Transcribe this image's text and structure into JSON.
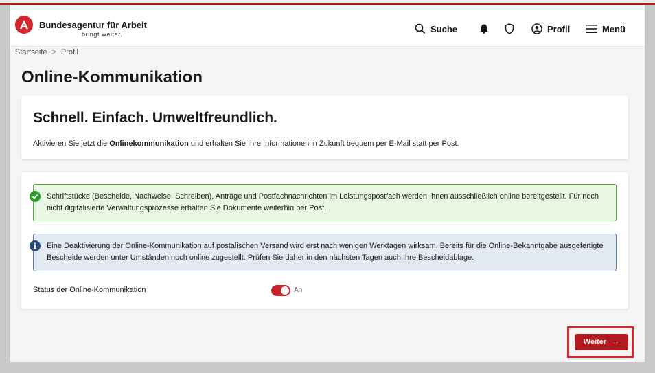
{
  "header": {
    "brand_name": "Bundesagentur für Arbeit",
    "brand_slogan": "bringt weiter.",
    "search_label": "Suche",
    "profile_label": "Profil",
    "menu_label": "Menü"
  },
  "breadcrumb": {
    "home": "Startseite",
    "separator": ">",
    "current": "Profil"
  },
  "page": {
    "title": "Online-Kommunikation"
  },
  "intro_card": {
    "heading": "Schnell. Einfach. Umweltfreundlich.",
    "text_before": "Aktivieren Sie jetzt die ",
    "text_bold": "Onlinekommunikation",
    "text_after": " und erhalten Sie Ihre Informationen in Zukunft bequem per E-Mail statt per Post."
  },
  "settings_card": {
    "success_alert": "Schriftstücke (Bescheide, Nachweise, Schreiben), Anträge und Postfachnachrichten im Leistungspostfach werden Ihnen ausschließlich online bereitgestellt. Für noch nicht digitalisierte Verwaltungsprozesse erhalten Sie Dokumente weiterhin per Post.",
    "info_icon_glyph": "i",
    "info_alert": "Eine Deaktivierung der Online-Kommunikation auf postalischen Versand wird erst nach wenigen Werktagen wirksam. Bereits für die Online-Bekanntgabe ausgefertigte Bescheide werden unter Umständen noch online zugestellt. Prüfen Sie daher in den nächsten Tagen auch Ihre Bescheidablage.",
    "status_label": "Status der Online-Kommunikation",
    "status_value": "An"
  },
  "actions": {
    "next_label": "Weiter",
    "next_arrow": "→"
  },
  "colors": {
    "brand_red": "#b11a1f",
    "success_green": "#2f9a2f",
    "info_blue": "#2c4d77"
  },
  "icons": [
    "ba-logo-icon",
    "search-icon",
    "bell-icon",
    "shield-icon",
    "user-circle-icon",
    "hamburger-icon",
    "check-circle-icon",
    "info-icon",
    "arrow-right-icon"
  ]
}
